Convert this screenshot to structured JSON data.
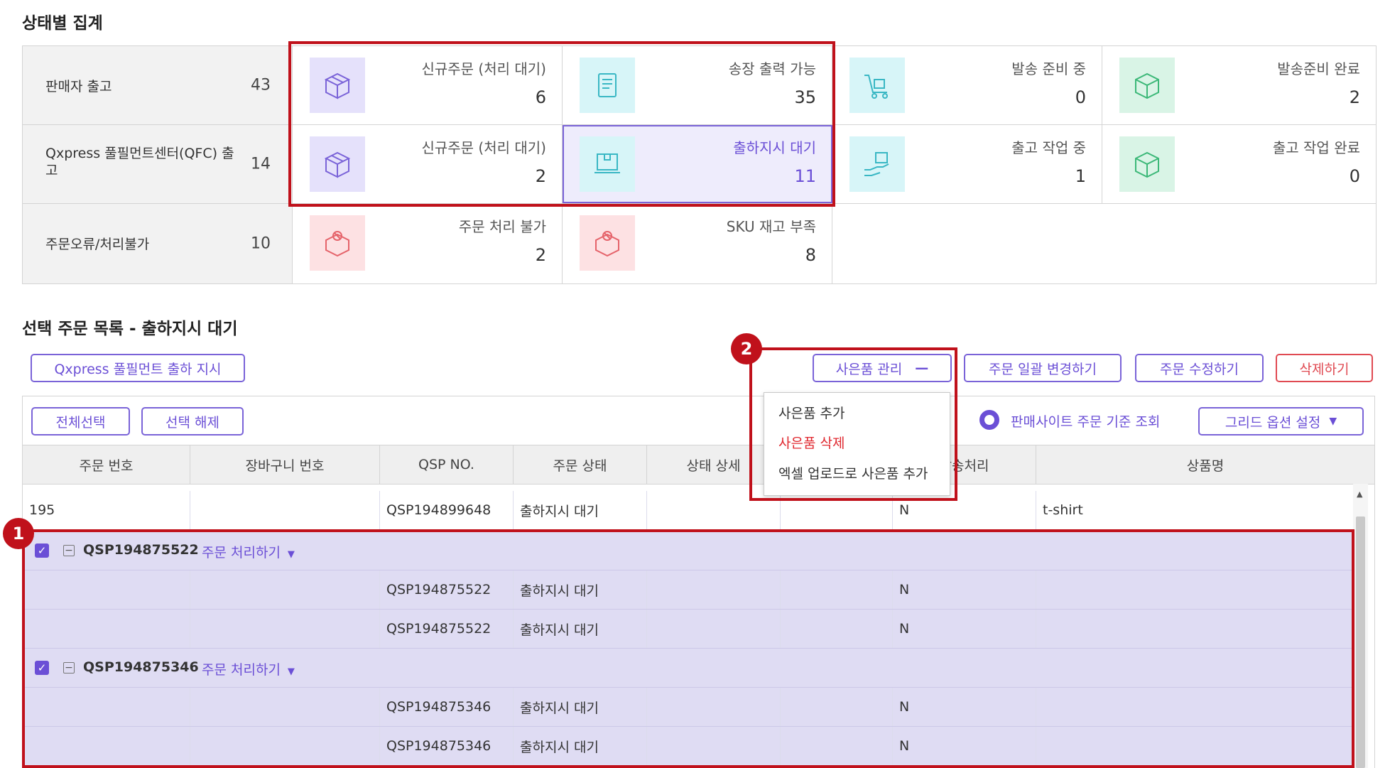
{
  "summary": {
    "title": "상태별 집계",
    "rows": [
      {
        "label": "판매자 출고",
        "count": "43",
        "cells": [
          {
            "title": "신규주문 (처리 대기)",
            "count": "6"
          },
          {
            "title": "송장 출력 가능",
            "count": "35"
          },
          {
            "title": "발송 준비 중",
            "count": "0"
          },
          {
            "title": "발송준비 완료",
            "count": "2"
          }
        ]
      },
      {
        "label": "Qxpress 풀필먼트센터(QFC) 출고",
        "count": "14",
        "cells": [
          {
            "title": "신규주문 (처리 대기)",
            "count": "2"
          },
          {
            "title": "출하지시 대기",
            "count": "11"
          },
          {
            "title": "출고 작업 중",
            "count": "1"
          },
          {
            "title": "출고 작업 완료",
            "count": "0"
          }
        ]
      },
      {
        "label": "주문오류/처리불가",
        "count": "10",
        "cells": [
          {
            "title": "주문 처리 불가",
            "count": "2"
          },
          {
            "title": "SKU 재고 부족",
            "count": "8"
          }
        ]
      }
    ]
  },
  "orders": {
    "title": "선택 주문 목록 - 출하지시 대기",
    "buttons": {
      "qxpress": "Qxpress 풀필먼트 출하 지시",
      "gift_manage": "사은품 관리",
      "bulk_change": "주문 일괄 변경하기",
      "edit_order": "주문 수정하기",
      "delete": "삭제하기",
      "select_all": "전체선택",
      "deselect": "선택 해제",
      "grid_options": "그리드 옵션 설정"
    },
    "radio_label": "판매사이트 주문 기준 조회",
    "gift_menu": [
      "사은품 추가",
      "사은품 삭제",
      "엑셀 업로드로 사은품 추가"
    ],
    "columns": [
      "주문 번호",
      "장바구니 번호",
      "QSP NO.",
      "주문 상태",
      "상태 상세",
      "",
      "발송처리",
      "상품명"
    ],
    "first_row": {
      "order_no": "195",
      "cart_no": "",
      "qsp": "QSP194899648",
      "status": "출하지시 대기",
      "shipping": "N",
      "product": "t-shirt"
    },
    "groups": [
      {
        "id": "QSP194875522",
        "action": "주문 처리하기",
        "rows": [
          {
            "qsp": "QSP194875522",
            "status": "출하지시 대기",
            "shipping": "N"
          },
          {
            "qsp": "QSP194875522",
            "status": "출하지시 대기",
            "shipping": "N"
          }
        ]
      },
      {
        "id": "QSP194875346",
        "action": "주문 처리하기",
        "rows": [
          {
            "qsp": "QSP194875346",
            "status": "출하지시 대기",
            "shipping": "N"
          },
          {
            "qsp": "QSP194875346",
            "status": "출하지시 대기",
            "shipping": "N"
          }
        ]
      }
    ]
  },
  "callouts": [
    "1",
    "2"
  ],
  "colors": {
    "accent": "#6b4fd6",
    "highlight": "#c0111b",
    "selected_row": "#dfdcf3"
  }
}
